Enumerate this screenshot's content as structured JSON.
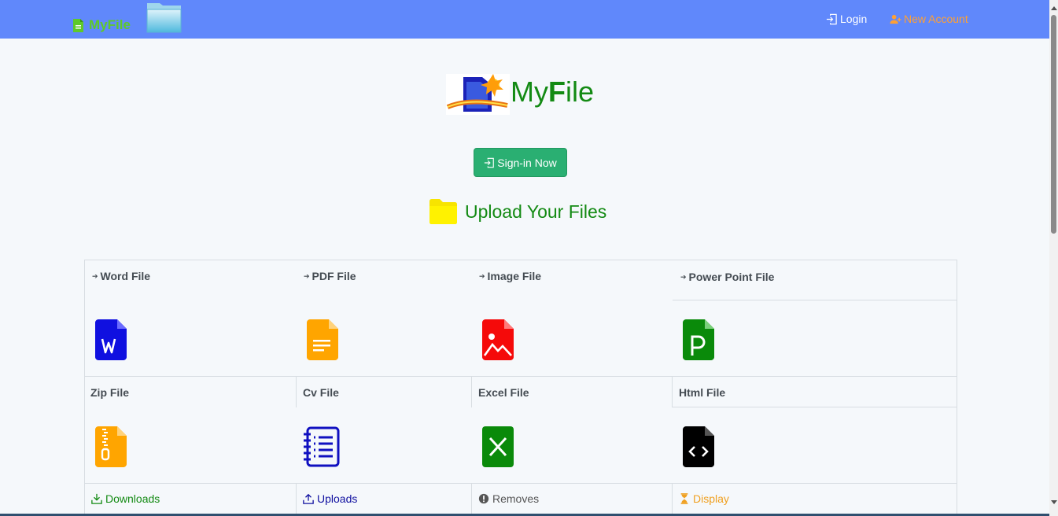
{
  "nav": {
    "brand": "MyFile",
    "login": "Login",
    "new_account": "New Account"
  },
  "hero": {
    "title_prefix": "My",
    "title_bold": "F",
    "title_suffix": "ile",
    "signin": "Sign-in Now",
    "upload_heading": "Upload Your Files"
  },
  "files": [
    {
      "label": "Word File",
      "icon": "word-icon",
      "color": "#1010e0"
    },
    {
      "label": "PDF File",
      "icon": "pdf-icon",
      "color": "#ffa500"
    },
    {
      "label": "Image File",
      "icon": "image-icon",
      "color": "#f50a0a"
    },
    {
      "label": "Power Point File",
      "icon": "powerpoint-icon",
      "color": "#0a8a0a"
    },
    {
      "label": "Zip File",
      "icon": "zip-icon",
      "color": "#ffa500"
    },
    {
      "label": "Cv File",
      "icon": "cv-icon",
      "color": "#1010c0"
    },
    {
      "label": "Excel File",
      "icon": "excel-icon",
      "color": "#0a8a0a"
    },
    {
      "label": "Html File",
      "icon": "html-icon",
      "color": "#000000"
    }
  ],
  "footer_links": [
    {
      "label": "Downloads",
      "color": "#138a13",
      "icon": "download-icon"
    },
    {
      "label": "Uploads",
      "color": "#1010a0",
      "icon": "upload-icon"
    },
    {
      "label": "Removes",
      "color": "#555555",
      "icon": "alert-icon"
    },
    {
      "label": "Display",
      "color": "#f0a020",
      "icon": "hourglass-icon"
    }
  ]
}
